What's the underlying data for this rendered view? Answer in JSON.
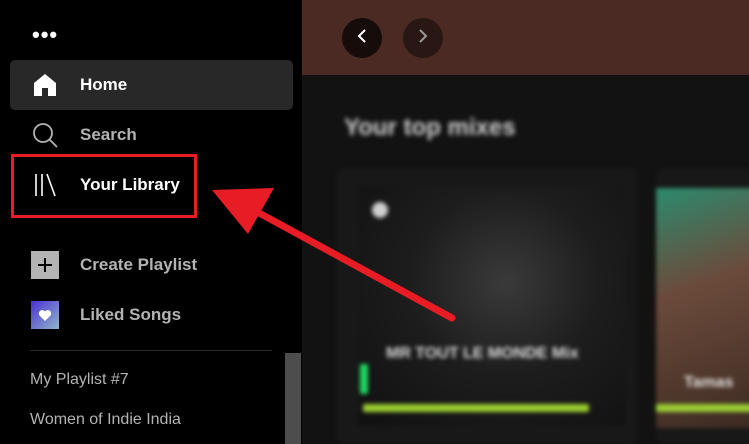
{
  "sidebar": {
    "menu_dots": "•••",
    "nav": [
      {
        "label": "Home",
        "icon": "home-icon"
      },
      {
        "label": "Search",
        "icon": "search-icon"
      },
      {
        "label": "Your Library",
        "icon": "library-icon"
      },
      {
        "label": "Create Playlist",
        "icon": "plus-icon"
      },
      {
        "label": "Liked Songs",
        "icon": "heart-icon"
      }
    ],
    "playlists": [
      "My Playlist #7",
      "Women of Indie India"
    ]
  },
  "main": {
    "section_title": "Your top mixes",
    "cards": [
      {
        "title": "MR TOUT LE MONDE Mix"
      },
      {
        "title": "Tamas"
      }
    ]
  },
  "colors": {
    "highlight": "#e81c24",
    "topbar": "#4a2a22",
    "accent_green": "#1ed760"
  }
}
